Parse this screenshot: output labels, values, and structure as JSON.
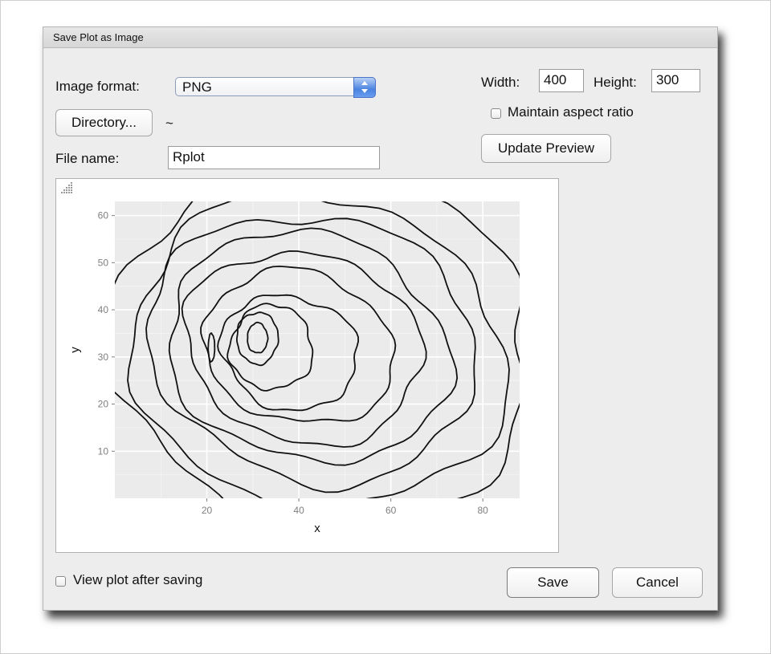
{
  "window": {
    "title": "Save Plot as Image"
  },
  "format": {
    "label": "Image format:",
    "value": "PNG"
  },
  "directory": {
    "button_label": "Directory...",
    "path": "~"
  },
  "file": {
    "label": "File name:",
    "value": "Rplot"
  },
  "size": {
    "width_label": "Width:",
    "width_value": "400",
    "height_label": "Height:",
    "height_value": "300",
    "maintain_aspect_label": "Maintain aspect ratio",
    "maintain_aspect_checked": false
  },
  "update_preview_label": "Update Preview",
  "view_after_saving": {
    "label": "View plot after saving",
    "checked": false
  },
  "buttons": {
    "save": "Save",
    "cancel": "Cancel"
  },
  "icons": [
    "select-arrows-icon",
    "resize-grip-icon",
    "checkbox-icon"
  ],
  "chart_data": {
    "type": "contour",
    "xlabel": "x",
    "ylabel": "y",
    "xlim": [
      0,
      88
    ],
    "ylim": [
      0,
      63
    ],
    "x_ticks": [
      20,
      40,
      60,
      80
    ],
    "y_ticks": [
      10,
      20,
      30,
      40,
      50,
      60
    ],
    "x_tick_labels": [
      "20",
      "40",
      "60",
      "80"
    ],
    "y_tick_labels": [
      "10",
      "20",
      "30",
      "40",
      "50",
      "60"
    ],
    "grid": true,
    "panel_background": "#ebebeb",
    "line_color": "#111111"
  }
}
